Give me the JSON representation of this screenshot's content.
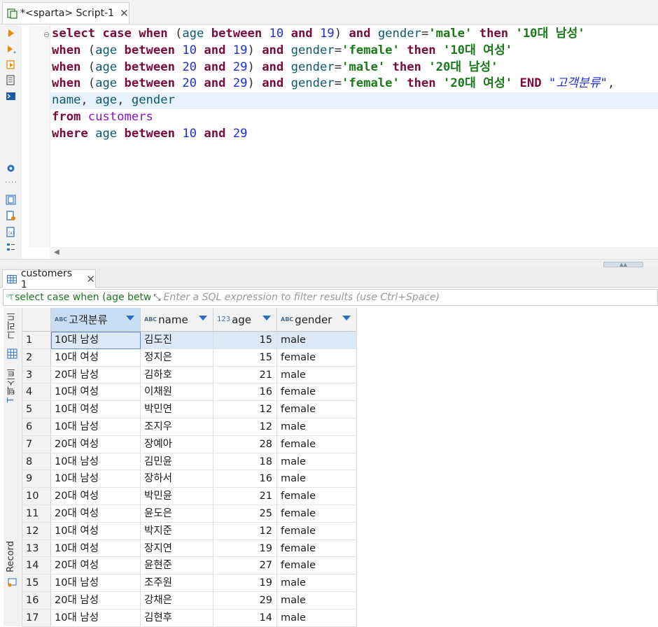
{
  "editor_tab": {
    "title": "*<sparta> Script-1",
    "close": "✕"
  },
  "sql_line_text": [
    "select case when (age between 10 and 19) and gender='male' then '10대 남성'",
    "when (age between 10 and 19) and gender='female' then '10대 여성'",
    "when (age between 20 and 29) and gender='male' then '20대 남성'",
    "when (age between 20 and 29) and gender='female' then '20대 여성' END \"고객분류\",",
    "name, age, gender",
    "from customers",
    "where age between 10 and 29"
  ],
  "sql_lines": [
    [
      [
        "k",
        "select"
      ],
      [
        "p",
        " "
      ],
      [
        "k",
        "case"
      ],
      [
        "p",
        " "
      ],
      [
        "k",
        "when"
      ],
      [
        "p",
        " ("
      ],
      [
        "i",
        "age"
      ],
      [
        "p",
        " "
      ],
      [
        "k",
        "between"
      ],
      [
        "p",
        " "
      ],
      [
        "n",
        "10"
      ],
      [
        "p",
        " "
      ],
      [
        "k",
        "and"
      ],
      [
        "p",
        " "
      ],
      [
        "n",
        "19"
      ],
      [
        "p",
        ") "
      ],
      [
        "k",
        "and"
      ],
      [
        "p",
        " "
      ],
      [
        "i",
        "gender"
      ],
      [
        "p",
        "="
      ],
      [
        "s",
        "'male'"
      ],
      [
        "p",
        " "
      ],
      [
        "k",
        "then"
      ],
      [
        "p",
        " "
      ],
      [
        "s",
        "'10대 남성'"
      ]
    ],
    [
      [
        "k",
        "when"
      ],
      [
        "p",
        " ("
      ],
      [
        "i",
        "age"
      ],
      [
        "p",
        " "
      ],
      [
        "k",
        "between"
      ],
      [
        "p",
        " "
      ],
      [
        "n",
        "10"
      ],
      [
        "p",
        " "
      ],
      [
        "k",
        "and"
      ],
      [
        "p",
        " "
      ],
      [
        "n",
        "19"
      ],
      [
        "p",
        ") "
      ],
      [
        "k",
        "and"
      ],
      [
        "p",
        " "
      ],
      [
        "i",
        "gender"
      ],
      [
        "p",
        "="
      ],
      [
        "s",
        "'female'"
      ],
      [
        "p",
        " "
      ],
      [
        "k",
        "then"
      ],
      [
        "p",
        " "
      ],
      [
        "s",
        "'10대 여성'"
      ]
    ],
    [
      [
        "k",
        "when"
      ],
      [
        "p",
        " ("
      ],
      [
        "i",
        "age"
      ],
      [
        "p",
        " "
      ],
      [
        "k",
        "between"
      ],
      [
        "p",
        " "
      ],
      [
        "n",
        "20"
      ],
      [
        "p",
        " "
      ],
      [
        "k",
        "and"
      ],
      [
        "p",
        " "
      ],
      [
        "n",
        "29"
      ],
      [
        "p",
        ") "
      ],
      [
        "k",
        "and"
      ],
      [
        "p",
        " "
      ],
      [
        "i",
        "gender"
      ],
      [
        "p",
        "="
      ],
      [
        "s",
        "'male'"
      ],
      [
        "p",
        " "
      ],
      [
        "k",
        "then"
      ],
      [
        "p",
        " "
      ],
      [
        "s",
        "'20대 남성'"
      ]
    ],
    [
      [
        "k",
        "when"
      ],
      [
        "p",
        " ("
      ],
      [
        "i",
        "age"
      ],
      [
        "p",
        " "
      ],
      [
        "k",
        "between"
      ],
      [
        "p",
        " "
      ],
      [
        "n",
        "20"
      ],
      [
        "p",
        " "
      ],
      [
        "k",
        "and"
      ],
      [
        "p",
        " "
      ],
      [
        "n",
        "29"
      ],
      [
        "p",
        ") "
      ],
      [
        "k",
        "and"
      ],
      [
        "p",
        " "
      ],
      [
        "i",
        "gender"
      ],
      [
        "p",
        "="
      ],
      [
        "s",
        "'female'"
      ],
      [
        "p",
        " "
      ],
      [
        "k",
        "then"
      ],
      [
        "p",
        " "
      ],
      [
        "s",
        "'20대 여성'"
      ],
      [
        "p",
        " "
      ],
      [
        "k",
        "END"
      ],
      [
        "p",
        " "
      ],
      [
        "q",
        "\"고객분류\""
      ],
      [
        "p",
        ","
      ]
    ],
    [
      [
        "i",
        "name"
      ],
      [
        "p",
        ", "
      ],
      [
        "i",
        "age"
      ],
      [
        "p",
        ", "
      ],
      [
        "i",
        "gender"
      ]
    ],
    [
      [
        "k",
        "from"
      ],
      [
        "p",
        " "
      ],
      [
        "t",
        "customers"
      ]
    ],
    [
      [
        "k",
        "where"
      ],
      [
        "p",
        " "
      ],
      [
        "i",
        "age"
      ],
      [
        "p",
        " "
      ],
      [
        "k",
        "between"
      ],
      [
        "p",
        " "
      ],
      [
        "n",
        "10"
      ],
      [
        "p",
        " "
      ],
      [
        "k",
        "and"
      ],
      [
        "p",
        " "
      ],
      [
        "n",
        "29"
      ]
    ]
  ],
  "results_tab": {
    "label": "customers 1",
    "close": "✕"
  },
  "filter": {
    "query_preview": "select case when (age betw",
    "placeholder": "Enter a SQL expression to filter results (use Ctrl+Space)"
  },
  "side_tabs": {
    "grid": "그리드",
    "text": "텍스트",
    "record": "Record"
  },
  "columns": [
    {
      "label": "고객분류",
      "type": "ABC"
    },
    {
      "label": "name",
      "type": "ABC"
    },
    {
      "label": "age",
      "type": "123"
    },
    {
      "label": "gender",
      "type": "ABC"
    }
  ],
  "rows": [
    [
      "1",
      "10대 남성",
      "김도진",
      "15",
      "male"
    ],
    [
      "2",
      "10대 여성",
      "정지은",
      "15",
      "female"
    ],
    [
      "3",
      "20대 남성",
      "김하호",
      "21",
      "male"
    ],
    [
      "4",
      "10대 여성",
      "이채원",
      "16",
      "female"
    ],
    [
      "5",
      "10대 여성",
      "박민연",
      "12",
      "female"
    ],
    [
      "6",
      "10대 남성",
      "조지우",
      "12",
      "male"
    ],
    [
      "7",
      "20대 여성",
      "장예아",
      "28",
      "female"
    ],
    [
      "8",
      "10대 남성",
      "김민윤",
      "18",
      "male"
    ],
    [
      "9",
      "10대 남성",
      "장하서",
      "16",
      "male"
    ],
    [
      "10",
      "20대 여성",
      "박민윤",
      "21",
      "female"
    ],
    [
      "11",
      "20대 여성",
      "윤도은",
      "25",
      "female"
    ],
    [
      "12",
      "10대 여성",
      "박지준",
      "12",
      "female"
    ],
    [
      "13",
      "10대 여성",
      "장지연",
      "19",
      "female"
    ],
    [
      "14",
      "20대 여성",
      "윤현준",
      "27",
      "female"
    ],
    [
      "15",
      "10대 남성",
      "조주원",
      "19",
      "male"
    ],
    [
      "16",
      "20대 남성",
      "강채은",
      "29",
      "male"
    ],
    [
      "17",
      "10대 남성",
      "김현후",
      "14",
      "male"
    ]
  ]
}
